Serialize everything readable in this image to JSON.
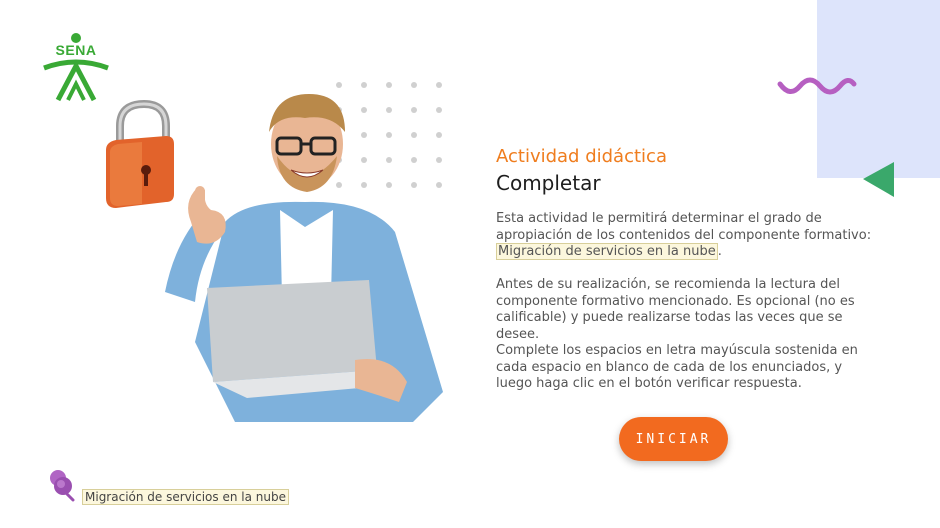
{
  "logo": {
    "text": "SENA",
    "color": "#39a935"
  },
  "activity": {
    "subtitle": "Actividad didáctica",
    "title": "Completar",
    "p1_text": "Esta actividad le permitirá determinar el grado de apropiación de los contenidos del componente formativo:",
    "p1_link": "Migración de servicios en la nube",
    "p1_end": ".",
    "p2": "Antes de su realización, se recomienda la lectura del componente formativo mencionado.  Es opcional (no es calificable) y puede realizarse todas las veces que se desee.",
    "p3": "Complete los espacios en letra mayúscula sostenida en cada espacio en blanco de cada de los enunciados, y luego haga clic en el botón verificar respuesta."
  },
  "start_button": {
    "label": "INICIAR"
  },
  "footer": {
    "label": "Migración de servicios en la nube"
  },
  "colors": {
    "accent_orange": "#ef7d1e",
    "button_orange": "#f26a1f",
    "wave_purple": "#b65fc1",
    "triangle_green": "#3aa86b",
    "panel_blue": "#dde4fb"
  },
  "icons": [
    "sena-logo-icon",
    "padlock-icon",
    "wave-icon",
    "triangle-icon",
    "pushpin-icon"
  ]
}
